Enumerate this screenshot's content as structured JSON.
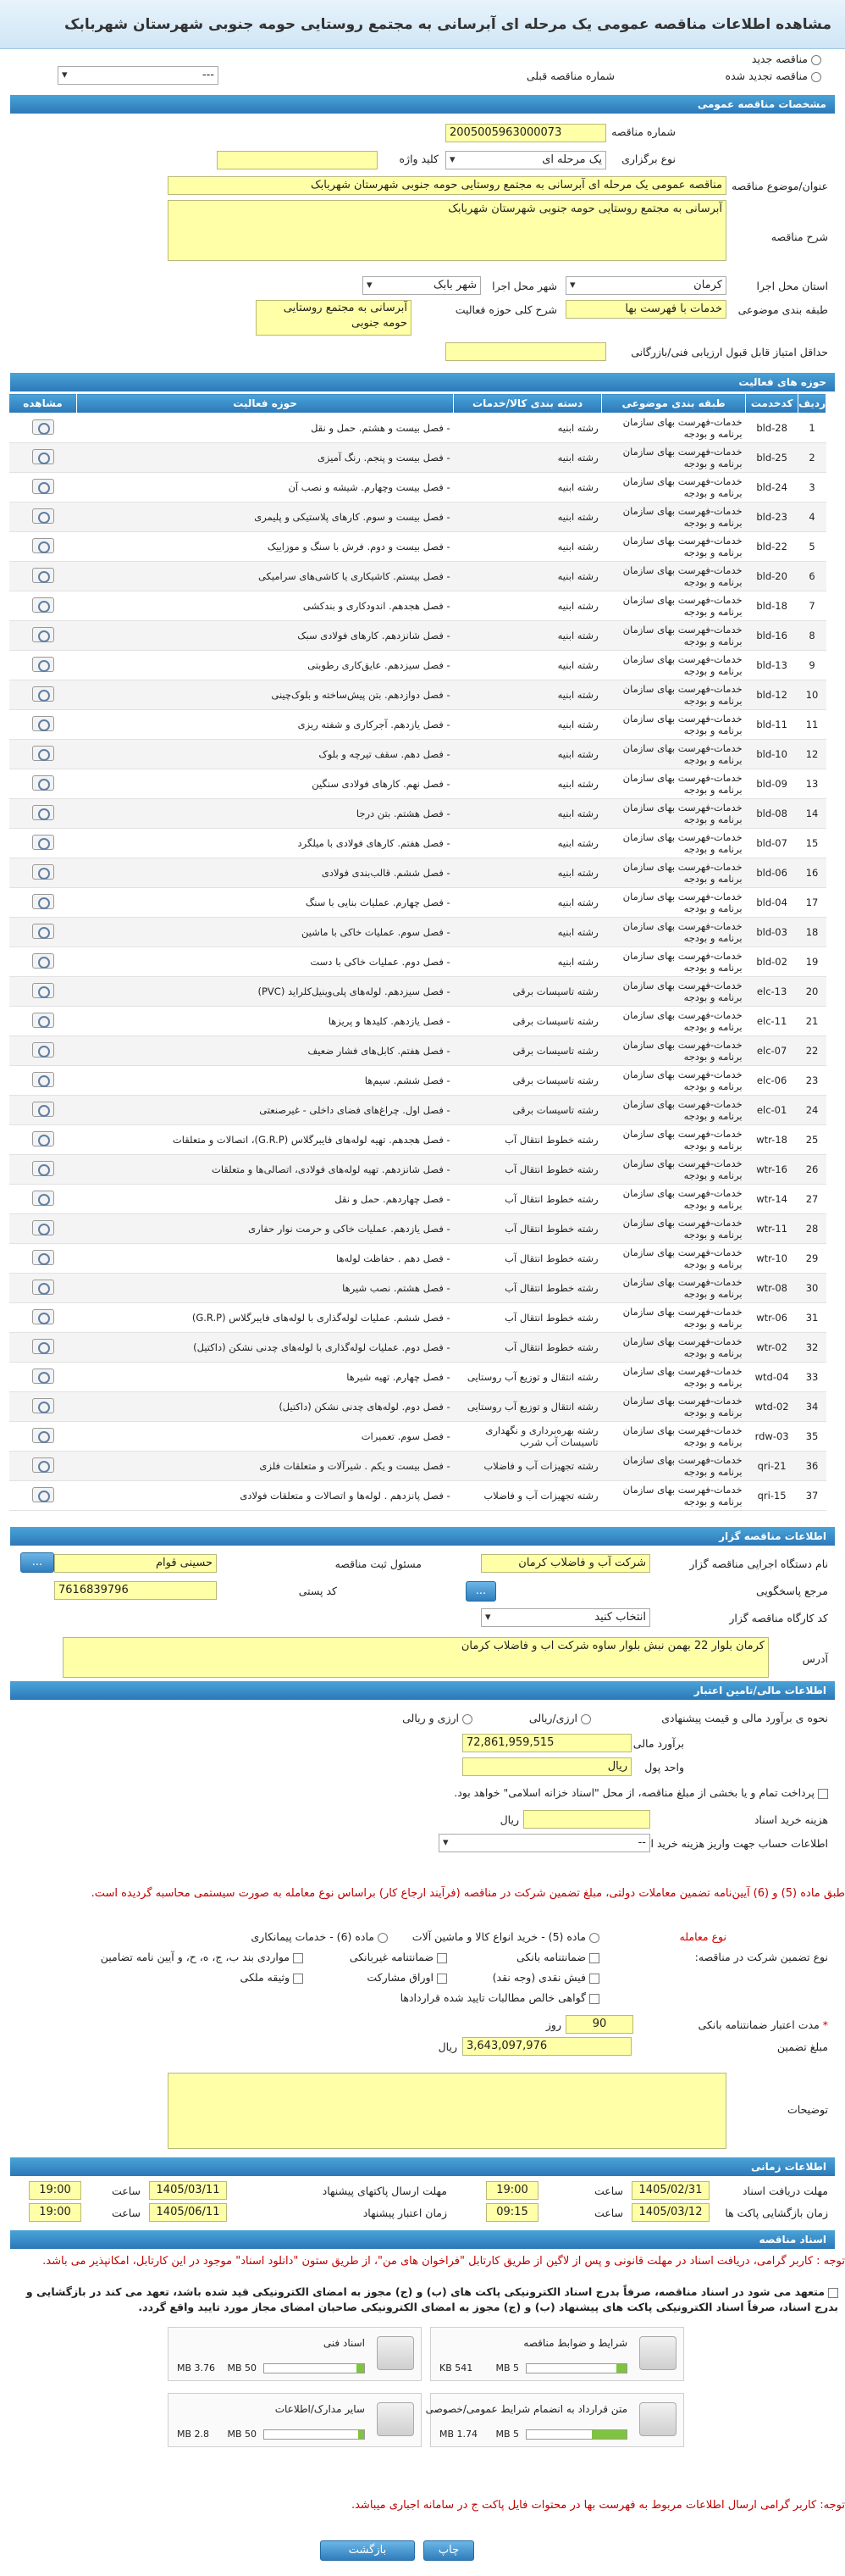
{
  "title": "مشاهده اطلاعات مناقصه عمومی یک مرحله ای آبرسانی به مجتمع روستایی حومه جنوبی شهرستان شهربابک",
  "top": {
    "new_label": "مناقصه جدید",
    "renewed_label": "مناقصه تجدید شده",
    "prev_label": "شماره مناقصه قبلی",
    "prev_value": "---"
  },
  "general": {
    "header": "مشخصات مناقصه عمومی",
    "number_label": "شماره مناقصه",
    "number_value": "2005005963000073",
    "type_label": "نوع برگزاری",
    "type_value": "یک مرحله ای",
    "keyword_label": "کلید واژه",
    "title_label": "عنوان/موضوع مناقصه",
    "title_value": "مناقصه عمومی یک مرحله ای آبرسانی به مجتمع روستایی حومه جنوبی شهرستان شهربابک",
    "desc_label": "شرح مناقصه",
    "desc_value": "آبرسانی به مجتمع روستایی حومه جنوبی شهرستان شهربابک",
    "province_label": "استان محل اجرا",
    "province_value": "کرمان",
    "city_label": "شهر محل اجرا",
    "city_value": "شهر بابک",
    "class_label": "طبقه بندی موضوعی",
    "class_value": "خدمات با فهرست بها",
    "scope_label": "شرح کلی حوزه فعالیت",
    "scope_value": "آبرسانی به مجتمع روستایی حومه جنوبی",
    "minscore_label": "حداقل امتیاز قابل قبول ارزیابی فنی/بازرگانی"
  },
  "scope": {
    "header": "حوزه های فعالیت",
    "columns": [
      "ردیف",
      "کدخدمت",
      "طبقه بندی موضوعی",
      "دسته بندی کالا/خدمات",
      "حوزه فعالیت",
      "مشاهده"
    ],
    "rows": [
      [
        "1",
        "bld-28",
        "خدمات-فهرست بهای سازمان برنامه و بودجه",
        "رشته ابنیه",
        "- فصل بیست و هشتم. حمل و نقل"
      ],
      [
        "2",
        "bld-25",
        "خدمات-فهرست بهای سازمان برنامه و بودجه",
        "رشته ابنیه",
        "- فصل بیست و پنجم. رنگ آمیزی"
      ],
      [
        "3",
        "bld-24",
        "خدمات-فهرست بهای سازمان برنامه و بودجه",
        "رشته ابنیه",
        "- فصل بیست وچهارم. شیشه و نصب آن"
      ],
      [
        "4",
        "bld-23",
        "خدمات-فهرست بهای سازمان برنامه و بودجه",
        "رشته ابنیه",
        "- فصل بیست و سوم. کارهای پلاستیکی و پلیمری"
      ],
      [
        "5",
        "bld-22",
        "خدمات-فهرست بهای سازمان برنامه و بودجه",
        "رشته ابنیه",
        "- فصل بیست و دوم. فرش با سنگ و موزاییک"
      ],
      [
        "6",
        "bld-20",
        "خدمات-فهرست بهای سازمان برنامه و بودجه",
        "رشته ابنیه",
        "- فصل بیستم. کاشیکاری یا کاشی‌های سرامیکی"
      ],
      [
        "7",
        "bld-18",
        "خدمات-فهرست بهای سازمان برنامه و بودجه",
        "رشته ابنیه",
        "- فصل هجدهم. اندودکاری و بندکشی"
      ],
      [
        "8",
        "bld-16",
        "خدمات-فهرست بهای سازمان برنامه و بودجه",
        "رشته ابنیه",
        "- فصل شانزدهم. کارهای فولادی سبک"
      ],
      [
        "9",
        "bld-13",
        "خدمات-فهرست بهای سازمان برنامه و بودجه",
        "رشته ابنیه",
        "- فصل سیزدهم. عایق‌کاری رطوبتی"
      ],
      [
        "10",
        "bld-12",
        "خدمات-فهرست بهای سازمان برنامه و بودجه",
        "رشته ابنیه",
        "- فصل دوازدهم. بتن پیش‌ساخته و بلوک‌چینی"
      ],
      [
        "11",
        "bld-11",
        "خدمات-فهرست بهای سازمان برنامه و بودجه",
        "رشته ابنیه",
        "- فصل یازدهم. آجرکاری و شفته ریزی"
      ],
      [
        "12",
        "bld-10",
        "خدمات-فهرست بهای سازمان برنامه و بودجه",
        "رشته ابنیه",
        "- فصل دهم. سقف تیرچه و بلوک"
      ],
      [
        "13",
        "bld-09",
        "خدمات-فهرست بهای سازمان برنامه و بودجه",
        "رشته ابنیه",
        "- فصل نهم. کارهای فولادی سنگین"
      ],
      [
        "14",
        "bld-08",
        "خدمات-فهرست بهای سازمان برنامه و بودجه",
        "رشته ابنیه",
        "- فصل هشتم. بتن درجا"
      ],
      [
        "15",
        "bld-07",
        "خدمات-فهرست بهای سازمان برنامه و بودجه",
        "رشته ابنیه",
        "- فصل هفتم. کارهای فولادی با میلگرد"
      ],
      [
        "16",
        "bld-06",
        "خدمات-فهرست بهای سازمان برنامه و بودجه",
        "رشته ابنیه",
        "- فصل ششم. قالب‌بندی فولادی"
      ],
      [
        "17",
        "bld-04",
        "خدمات-فهرست بهای سازمان برنامه و بودجه",
        "رشته ابنیه",
        "- فصل چهارم. عملیات بنایی با سنگ"
      ],
      [
        "18",
        "bld-03",
        "خدمات-فهرست بهای سازمان برنامه و بودجه",
        "رشته ابنیه",
        "- فصل سوم. عملیات خاکی با ماشین"
      ],
      [
        "19",
        "bld-02",
        "خدمات-فهرست بهای سازمان برنامه و بودجه",
        "رشته ابنیه",
        "- فصل دوم. عملیات خاکی با دست"
      ],
      [
        "20",
        "elc-13",
        "خدمات-فهرست بهای سازمان برنامه و بودجه",
        "رشته تاسیسات برقی",
        "- فصل سیزدهم. لوله‌های پلی‌وینیل‌کلراید (PVC)"
      ],
      [
        "21",
        "elc-11",
        "خدمات-فهرست بهای سازمان برنامه و بودجه",
        "رشته تاسیسات برقی",
        "- فصل یازدهم. کلیدها و پریزها"
      ],
      [
        "22",
        "elc-07",
        "خدمات-فهرست بهای سازمان برنامه و بودجه",
        "رشته تاسیسات برقی",
        "- فصل هفتم. کابل‌های فشار ضعیف"
      ],
      [
        "23",
        "elc-06",
        "خدمات-فهرست بهای سازمان برنامه و بودجه",
        "رشته تاسیسات برقی",
        "- فصل ششم. سیم‌ها"
      ],
      [
        "24",
        "elc-01",
        "خدمات-فهرست بهای سازمان برنامه و بودجه",
        "رشته تاسیسات برقی",
        "- فصل اول. چراغ‌های فضای داخلی - غیرصنعتی"
      ],
      [
        "25",
        "wtr-18",
        "خدمات-فهرست بهای سازمان برنامه و بودجه",
        "رشته خطوط انتقال آب",
        "- فصل هجدهم. تهیه لوله‌های فایبرگلاس (G.R.P)، اتصالات و متعلقات"
      ],
      [
        "26",
        "wtr-16",
        "خدمات-فهرست بهای سازمان برنامه و بودجه",
        "رشته خطوط انتقال آب",
        "- فصل شانزدهم. تهیه لوله‌های فولادی، اتصالی‌ها و متعلقات"
      ],
      [
        "27",
        "wtr-14",
        "خدمات-فهرست بهای سازمان برنامه و بودجه",
        "رشته خطوط انتقال آب",
        "- فصل چهاردهم. حمل و نقل"
      ],
      [
        "28",
        "wtr-11",
        "خدمات-فهرست بهای سازمان برنامه و بودجه",
        "رشته خطوط انتقال آب",
        "- فصل یازدهم. عملیات خاکی و حرمت نوار حفاری"
      ],
      [
        "29",
        "wtr-10",
        "خدمات-فهرست بهای سازمان برنامه و بودجه",
        "رشته خطوط انتقال آب",
        "- فصل دهم . حفاظت لوله‌ها"
      ],
      [
        "30",
        "wtr-08",
        "خدمات-فهرست بهای سازمان برنامه و بودجه",
        "رشته خطوط انتقال آب",
        "- فصل هشتم. نصب شیرها"
      ],
      [
        "31",
        "wtr-06",
        "خدمات-فهرست بهای سازمان برنامه و بودجه",
        "رشته خطوط انتقال آب",
        "- فصل ششم. عملیات لوله‌گذاری با لوله‌های فایبرگلاس (G.R.P)"
      ],
      [
        "32",
        "wtr-02",
        "خدمات-فهرست بهای سازمان برنامه و بودجه",
        "رشته خطوط انتقال آب",
        "- فصل دوم. عملیات لوله‌گذاری با لوله‌های چدنی نشکن (داکتیل)"
      ],
      [
        "33",
        "wtd-04",
        "خدمات-فهرست بهای سازمان برنامه و بودجه",
        "رشته انتقال و توزیع آب روستایی",
        "- فصل چهارم. تهیه شیرها"
      ],
      [
        "34",
        "wtd-02",
        "خدمات-فهرست بهای سازمان برنامه و بودجه",
        "رشته انتقال و توزیع آب روستایی",
        "- فصل دوم. لوله‌های چدنی نشکن (داکتیل)"
      ],
      [
        "35",
        "rdw-03",
        "خدمات-فهرست بهای سازمان برنامه و بودجه",
        "رشته بهره‌برداری و نگهداری تاسیسات آب شرب",
        "- فصل سوم. تعمیرات"
      ],
      [
        "36",
        "qri-21",
        "خدمات-فهرست بهای سازمان برنامه و بودجه",
        "رشته تجهیزات آب و فاضلاب",
        "- فصل بیست و یکم . شیرآلات و متعلقات فلزی"
      ],
      [
        "37",
        "qri-15",
        "خدمات-فهرست بهای سازمان برنامه و بودجه",
        "رشته تجهیزات آب و فاضلاب",
        "- فصل پانزدهم . لوله‌ها و اتصالات و متعلقات فولادی"
      ]
    ]
  },
  "organizer": {
    "header": "اطلاعات مناقصه گزار",
    "name_label": "نام دستگاه اجرایی مناقصه گزار",
    "name_value": "شرکت آب و فاضلاب کرمان",
    "resp_label": "مسئول ثبت مناقصه",
    "resp_value": "حسینی قوام",
    "ref_label": "مرجع پاسخگویی",
    "postal_label": "کد پستی",
    "postal_value": "7616839796",
    "workshop_label": "کد کارگاه مناقصه گزار",
    "workshop_value": "انتخاب کنید",
    "address_label": "آدرس",
    "address_value": "کرمان بلوار 22 بهمن نبش بلوار ساوه شرکت اب و فاضلاب کرمان",
    "dots": "..."
  },
  "finance": {
    "header": "اطلاعات مالی/تامین اعتبار",
    "estimate_label": "نحوه ی برآورد مالی و قیمت پیشنهادی",
    "rial_label": "ارزی/ریالی",
    "fx_label": "ارزی و ریالی",
    "estimate_amount_label": "برآورد مالی",
    "estimate_amount": "72,861,959,515",
    "currency_label": "واحد پول",
    "currency_value": "ریال",
    "payment_note": "پرداخت تمام و یا بخشی از مبلغ مناقصه، از محل \"اسناد خزانه اسلامی\" خواهد بود.",
    "doc_fee_label": "هزینه خرید اسناد",
    "doc_fee_unit": "ریال",
    "account_label": "اطلاعات حساب جهت واریز هزینه خرید اسناد",
    "account_value": "--",
    "warning": "طبق ماده (5) و (6) آیین‌نامه تضمین معاملات دولتی، مبلغ تضمین شرکت در مناقصه (فرآیند ارجاع کار) براساس نوع معامله به صورت سیستمی محاسبه گردیده است.",
    "type_label": "نوع معامله",
    "type_opts": [
      "ماده (5) - خرید انواع کالا و ماشین آلات",
      "ماده (6) - خدمات پیمانکاری"
    ],
    "guarantee_label": "نوع تضمین شرکت در مناقصه:",
    "g_opts": [
      "ضمانتنامه بانکی",
      "ضمانتنامه غیربانکی",
      "مواردی بند ب، ج، ه، ح، و آیین نامه تضامین",
      "فیش نقدی (وجه نقد)",
      "اوراق مشارکت",
      "وثیقه ملکی",
      "گواهی خالص مطالبات تایید شده قراردادها"
    ],
    "validity_label": "مدت اعتبار ضمانتنامه بانکی",
    "validity_value": "90",
    "validity_unit": "روز",
    "amount_label": "مبلغ تضمین",
    "amount_value": "3,643,097,976",
    "amount_unit": "ریال",
    "desc_label": "توضیحات"
  },
  "times": {
    "header": "اطلاعات زمانی",
    "receive_label": "مهلت دریافت اسناد",
    "receive_date": "1405/02/31",
    "receive_time": "19:00",
    "send_label": "مهلت ارسال پاکتهای پیشنهاد",
    "send_date": "1405/03/11",
    "send_time": "19:00",
    "open_label": "زمان بازگشایی پاکت ها",
    "open_date": "1405/03/12",
    "open_time": "09:15",
    "valid_label": "زمان اعتبار پیشنهاد",
    "valid_date": "1405/06/11",
    "valid_time": "19:00",
    "hour_label": "ساعت"
  },
  "docs": {
    "header": "اسناد مناقصه",
    "note1": "توجه : کاربر گرامی، دریافت اسناد در مهلت قانونی و پس از لاگین از طریق کارتابل \"فراخوان های من\"، از طریق ستون \"دانلود اسناد\" موجود در این کارتابل، امکانپذیر می باشد.",
    "pledge": "متعهد می شود در اسناد مناقصه، صرفاً بدرج اسناد الکترونیکی پاکت های (ب) و (ج) مجوز به امضای الکترونیکی قید شده باشد، تعهد می کند در بازگشایی و بدرج اسناد، صرفاً اسناد الکترونیکی پاکت های پیشنهاد (ب) و (ج) مجوز به امضای الکترونیکی صاحبان امضای مجاز مورد تایید واقع گردد.",
    "files": [
      {
        "name": "شرایط و ضوابط مناقصه",
        "size": "541 KB",
        "max": "5 MB",
        "fill": 0.1
      },
      {
        "name": "اسناد فنی",
        "size": "3.76 MB",
        "max": "50 MB",
        "fill": 0.08
      },
      {
        "name": "متن قرارداد به انضمام شرایط عمومی/خصوصی",
        "size": "1.74 MB",
        "max": "5 MB",
        "fill": 0.35
      },
      {
        "name": "سایر مدارک/اطلاعات",
        "size": "2.8 MB",
        "max": "50 MB",
        "fill": 0.06
      }
    ],
    "note2": "توجه: کاربر گرامی ارسال اطلاعات مربوط به فهرست بها در محتوات فایل پاکت ج در سامانه اجباری میباشد."
  },
  "buttons": {
    "back": "بازگشت",
    "print": "چاپ"
  }
}
